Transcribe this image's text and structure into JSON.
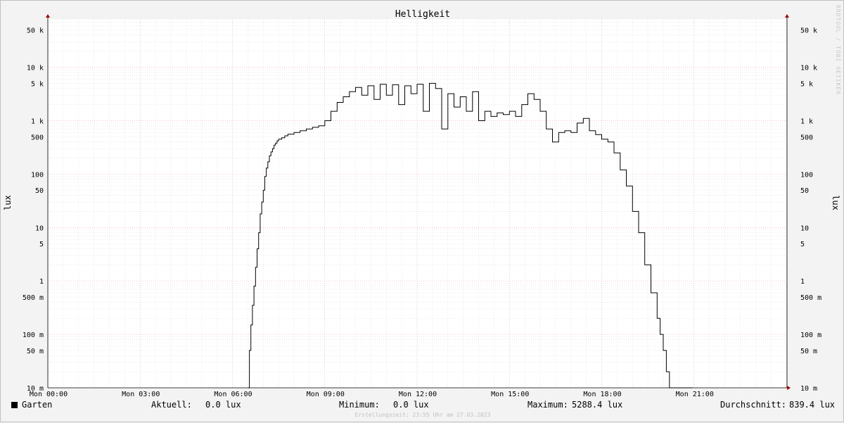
{
  "title": "Helligkeit",
  "watermark": "RRDTOOL / TOBI OETIKER",
  "creation": "Erstellungszeit: 23:55 Uhr am 27.03.2023",
  "colors": {
    "line": "#000000",
    "minor_grid": "#dcdcdc",
    "major_grid": "#e8a0a0",
    "background": "#ffffff",
    "frame": "#f3f3f3"
  },
  "legend": {
    "series_name": "Garten",
    "current_label": "Aktuell:",
    "current_value": "0.0 lux",
    "min_label": "Minimum:",
    "min_value": "0.0 lux",
    "max_label": "Maximum:",
    "max_value": "5288.4 lux",
    "avg_label": "Durchschnitt:",
    "avg_value": "839.4 lux"
  },
  "chart_data": {
    "type": "line",
    "title": "Helligkeit",
    "ylabel": "lux",
    "yscale": "log",
    "ylim": [
      0.01,
      80000
    ],
    "xlim": [
      0,
      24
    ],
    "grid": true,
    "y_ticks": [
      {
        "value": 50000,
        "label": "50 k"
      },
      {
        "value": 10000,
        "label": "10 k"
      },
      {
        "value": 5000,
        "label": "5 k"
      },
      {
        "value": 1000,
        "label": "1 k"
      },
      {
        "value": 500,
        "label": "500"
      },
      {
        "value": 100,
        "label": "100"
      },
      {
        "value": 50,
        "label": "50"
      },
      {
        "value": 10,
        "label": "10"
      },
      {
        "value": 5,
        "label": "5"
      },
      {
        "value": 1,
        "label": "1"
      },
      {
        "value": 0.5,
        "label": "500 m"
      },
      {
        "value": 0.1,
        "label": "100 m"
      },
      {
        "value": 0.05,
        "label": "50 m"
      },
      {
        "value": 0.01,
        "label": "10 m"
      }
    ],
    "x_ticks": [
      {
        "value": 0,
        "label": "Mon 00:00"
      },
      {
        "value": 3,
        "label": "Mon 03:00"
      },
      {
        "value": 6,
        "label": "Mon 06:00"
      },
      {
        "value": 9,
        "label": "Mon 09:00"
      },
      {
        "value": 12,
        "label": "Mon 12:00"
      },
      {
        "value": 15,
        "label": "Mon 15:00"
      },
      {
        "value": 18,
        "label": "Mon 18:00"
      },
      {
        "value": 21,
        "label": "Mon 21:00"
      }
    ],
    "series": [
      {
        "x": [
          6.5,
          6.55,
          6.6,
          6.65,
          6.7,
          6.75,
          6.8,
          6.85,
          6.9,
          6.95,
          7.0,
          7.05,
          7.1,
          7.15,
          7.2,
          7.25,
          7.3,
          7.35,
          7.4,
          7.45,
          7.5,
          7.6,
          7.7,
          7.8,
          8.0,
          8.2,
          8.4,
          8.6,
          8.8,
          9.0,
          9.2,
          9.4,
          9.6,
          9.8,
          10.0,
          10.2,
          10.4,
          10.6,
          10.8,
          11.0,
          11.2,
          11.4,
          11.6,
          11.8,
          12.0,
          12.2,
          12.4,
          12.6,
          12.8,
          13.0,
          13.2,
          13.4,
          13.6,
          13.8,
          14.0,
          14.2,
          14.4,
          14.6,
          14.8,
          15.0,
          15.2,
          15.4,
          15.6,
          15.8,
          16.0,
          16.2,
          16.4,
          16.6,
          16.8,
          17.0,
          17.2,
          17.4,
          17.6,
          17.8,
          18.0,
          18.2,
          18.4,
          18.6,
          18.8,
          19.0,
          19.2,
          19.4,
          19.6,
          19.8,
          19.9,
          20.0,
          20.1,
          20.2,
          20.3,
          20.4,
          20.5,
          20.6,
          20.7,
          20.75,
          20.8,
          20.85,
          20.9,
          20.95
        ],
        "y": [
          0.01,
          0.05,
          0.15,
          0.35,
          0.8,
          1.8,
          4,
          8,
          18,
          30,
          50,
          90,
          130,
          170,
          220,
          260,
          300,
          350,
          380,
          420,
          450,
          480,
          520,
          560,
          600,
          650,
          700,
          750,
          800,
          1000,
          1500,
          2200,
          2800,
          3500,
          4200,
          3000,
          4500,
          2500,
          4800,
          3000,
          4700,
          2000,
          4500,
          3200,
          4800,
          1500,
          5000,
          4000,
          700,
          3200,
          1800,
          2800,
          1500,
          3500,
          1000,
          1500,
          1200,
          1400,
          1300,
          1500,
          1200,
          2000,
          3200,
          2500,
          1500,
          700,
          400,
          600,
          650,
          600,
          900,
          1100,
          650,
          550,
          450,
          400,
          250,
          120,
          60,
          20,
          8,
          2,
          0.6,
          0.2,
          0.1,
          0.05,
          0.02,
          0.01,
          0.01,
          0.01,
          0.01,
          0.01,
          0.01,
          0.01,
          0.01,
          0.01,
          0.01,
          0.01
        ],
        "color": "#000000"
      }
    ]
  }
}
